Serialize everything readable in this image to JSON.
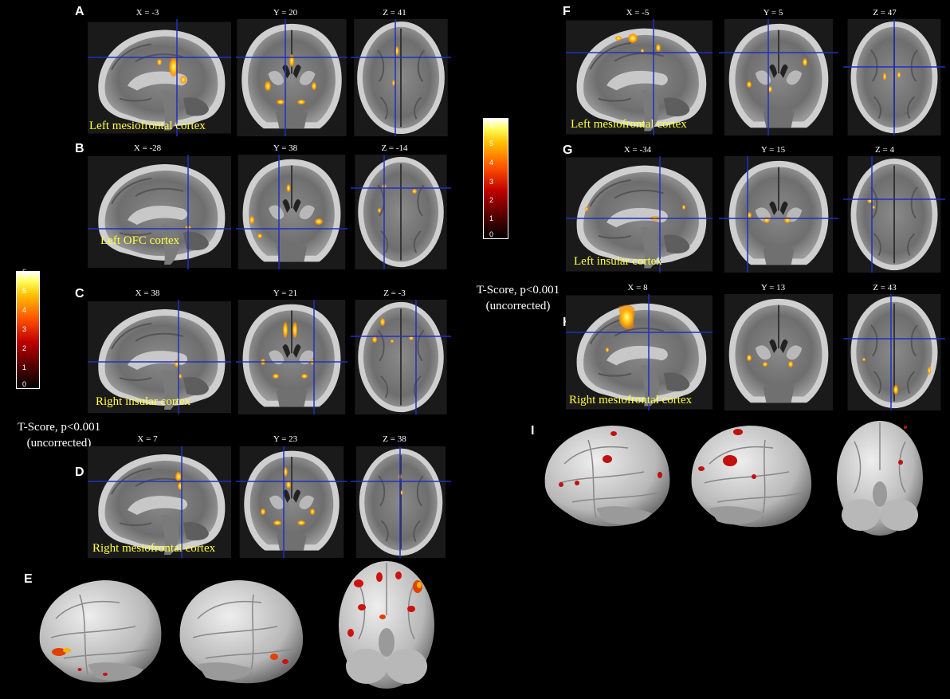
{
  "panels": [
    {
      "letter": "A",
      "coords": [
        "X = -3",
        "Y = 20",
        "Z = 41"
      ],
      "region": "Left mesiofrontal cortex"
    },
    {
      "letter": "B",
      "coords": [
        "X = -28",
        "Y = 38",
        "Z = -14"
      ],
      "region": "Left OFC cortex"
    },
    {
      "letter": "C",
      "coords": [
        "X = 38",
        "Y = 21",
        "Z = -3"
      ],
      "region": "Right insular cortex"
    },
    {
      "letter": "D",
      "coords": [
        "X = 7",
        "Y = 23",
        "Z = 38"
      ],
      "region": "Right mesiofrontal cortex"
    },
    {
      "letter": "E"
    },
    {
      "letter": "F",
      "coords": [
        "X = -5",
        "Y = 5",
        "Z = 47"
      ],
      "region": "Left mesiofrontal cortex"
    },
    {
      "letter": "G",
      "coords": [
        "X = -34",
        "Y = 15",
        "Z = 4"
      ],
      "region": "Left insular cortex"
    },
    {
      "letter": "H",
      "coords": [
        "X = 8",
        "Y = 13",
        "Z = 43"
      ],
      "region": "Right mesiofrontal cortex"
    },
    {
      "letter": "I"
    }
  ],
  "colorbar_left": {
    "ticks": [
      "6",
      "5",
      "4",
      "3",
      "2",
      "1",
      "0"
    ]
  },
  "colorbar_right": {
    "ticks": [
      "6",
      "5",
      "4",
      "3",
      "2",
      "1",
      "0"
    ]
  },
  "tscore_left": {
    "line1": "T-Score, p<0.001",
    "line2": "(uncorrected)"
  },
  "tscore_right": {
    "line1": "T-Score, p<0.001",
    "line2": "(uncorrected)"
  }
}
